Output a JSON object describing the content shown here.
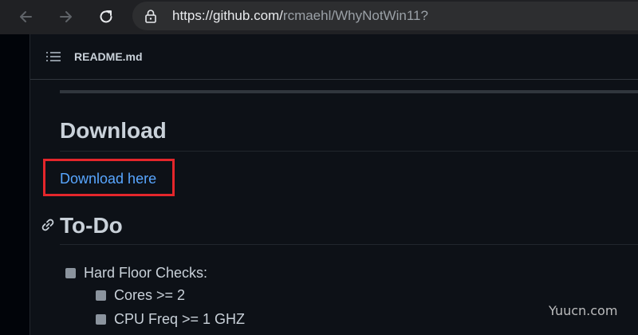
{
  "browser": {
    "url_host": "https://github.com/",
    "url_path": "rcmaehl/WhyNotWin11?"
  },
  "file_header": {
    "file_name": "README.md"
  },
  "readme": {
    "download_heading": "Download",
    "download_link": "Download here",
    "todo_heading": "To-Do",
    "tasks": [
      {
        "label": "Hard Floor Checks:",
        "checked": true
      },
      {
        "label": "Cores >= 2",
        "checked": true
      },
      {
        "label": "CPU Freq >= 1 GHZ",
        "checked": true
      }
    ]
  },
  "watermark": "Yuucn.com",
  "colors": {
    "link": "#58a6ff",
    "highlight_box": "#e4262b",
    "background": "#0d1117"
  },
  "icons": {
    "back": "back-arrow-icon",
    "forward": "forward-arrow-icon",
    "reload": "reload-icon",
    "lock": "lock-icon",
    "list": "list-icon",
    "anchor": "link-icon"
  }
}
